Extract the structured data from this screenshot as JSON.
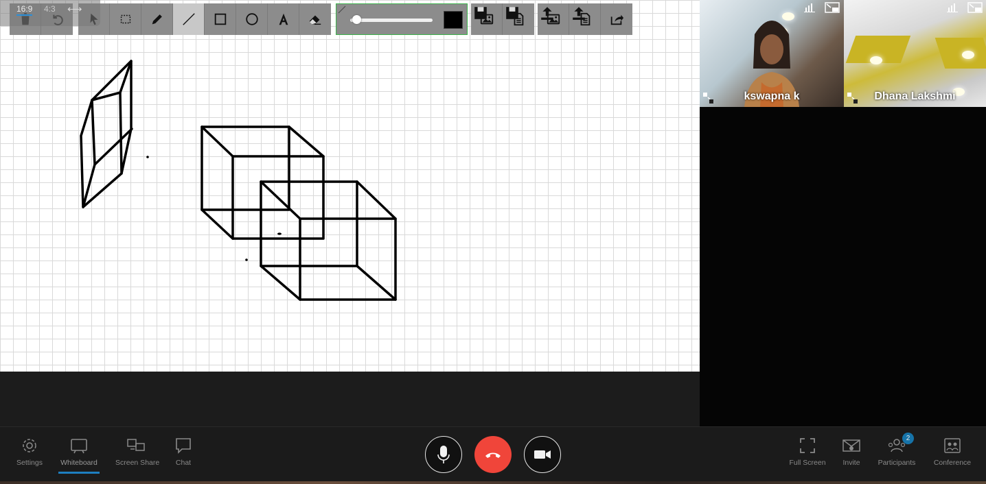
{
  "aspect": {
    "ratio_16_9": "16:9",
    "ratio_4_3": "4:3",
    "swap_glyph": "⟷"
  },
  "toolbar": {
    "groups": [
      [
        "trash-icon",
        "undo-icon"
      ],
      [
        "select-pointer-icon",
        "marquee-select-icon",
        "pencil-icon",
        "line-tool-icon",
        "rectangle-tool-icon",
        "circle-tool-icon",
        "text-tool-icon",
        "eraser-icon"
      ],
      [
        "save-image-icon",
        "save-document-icon"
      ],
      [
        "upload-image-icon",
        "upload-document-icon",
        "share-icon"
      ]
    ],
    "active_tool": "line-tool-icon",
    "stroke_color": "#000000",
    "stroke_width_level": 0.05
  },
  "participants": [
    {
      "name": "kswapna k"
    },
    {
      "name": "Dhana Lakshmi"
    }
  ],
  "bottom_nav": {
    "settings": "Settings",
    "whiteboard": "Whiteboard",
    "screen_share": "Screen Share",
    "chat": "Chat",
    "full_screen": "Full Screen",
    "invite": "Invite",
    "participants": "Participants",
    "participants_count": "2",
    "conference": "Conference"
  },
  "colors": {
    "end_call": "#f0453a",
    "accent": "#1e7fc0",
    "selected_outline": "#3ab24a"
  }
}
